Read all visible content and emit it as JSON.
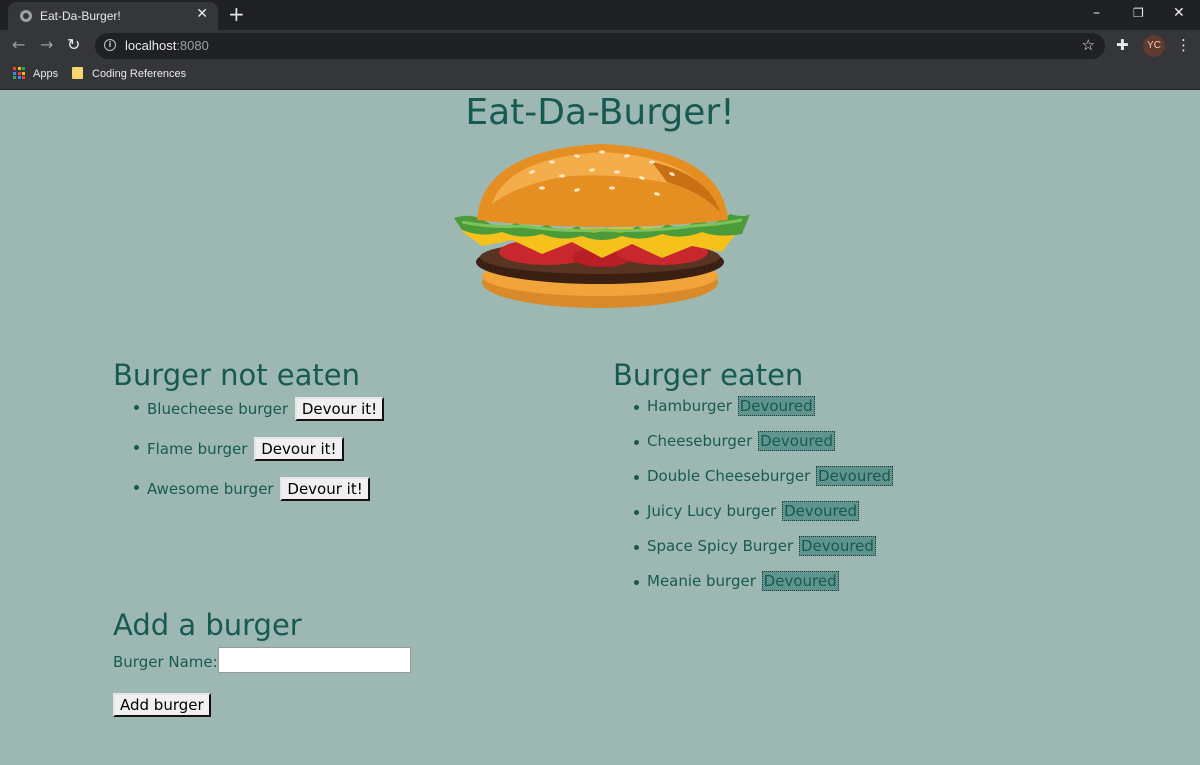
{
  "browser": {
    "tab_title": "Eat-Da-Burger!",
    "url_host": "localhost",
    "url_port": ":8080",
    "avatar_initials": "YC",
    "bookmarks": [
      {
        "label": "Apps",
        "icon": "apps-grid-icon"
      },
      {
        "label": "Coding References",
        "icon": "folder-icon"
      }
    ]
  },
  "page": {
    "title": "Eat-Da-Burger!",
    "not_eaten": {
      "heading": "Burger not eaten",
      "button_label": "Devour it!",
      "items": [
        "Bluecheese burger",
        "Flame burger",
        "Awesome burger"
      ]
    },
    "eaten": {
      "heading": "Burger eaten",
      "badge_label": "Devoured",
      "items": [
        "Hamburger",
        "Cheeseburger",
        "Double Cheeseburger",
        "Juicy Lucy burger",
        "Space Spicy Burger",
        "Meanie burger"
      ]
    },
    "add_form": {
      "heading": "Add a burger",
      "label": "Burger Name:",
      "input_value": "",
      "submit_label": "Add burger"
    }
  },
  "colors": {
    "page_bg": "#9db8b3",
    "text_teal": "#175a52",
    "devoured_bg": "#5f958d",
    "chrome_dark": "#202124",
    "chrome_toolbar": "#35363a"
  }
}
